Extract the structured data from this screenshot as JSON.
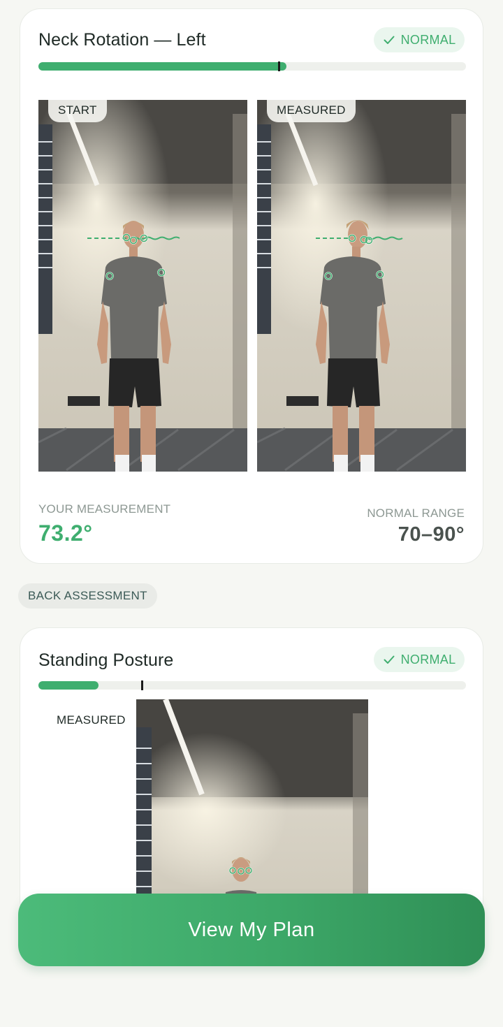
{
  "neck_card": {
    "title": "Neck Rotation — Left",
    "status": "NORMAL",
    "progress_fraction": 0.58,
    "marker_fraction": 0.56,
    "photos": [
      {
        "label": "START"
      },
      {
        "label": "MEASURED"
      }
    ],
    "your_measurement_label": "YOUR MEASUREMENT",
    "your_measurement_value": "73.2°",
    "normal_range_label": "NORMAL RANGE",
    "normal_range_value": "70–90°"
  },
  "section_chip": "BACK ASSESSMENT",
  "posture_card": {
    "title": "Standing Posture",
    "status": "NORMAL",
    "progress_fraction": 0.14,
    "marker_fraction": 0.24,
    "measured_label": "MEASURED"
  },
  "cta": {
    "label": "View My Plan"
  },
  "colors": {
    "accent": "#3fae6f",
    "badge_bg": "#eaf6ee",
    "cta_start": "#4cbb7a",
    "cta_end": "#2f8f56"
  },
  "icons": {
    "status": "check-icon"
  }
}
